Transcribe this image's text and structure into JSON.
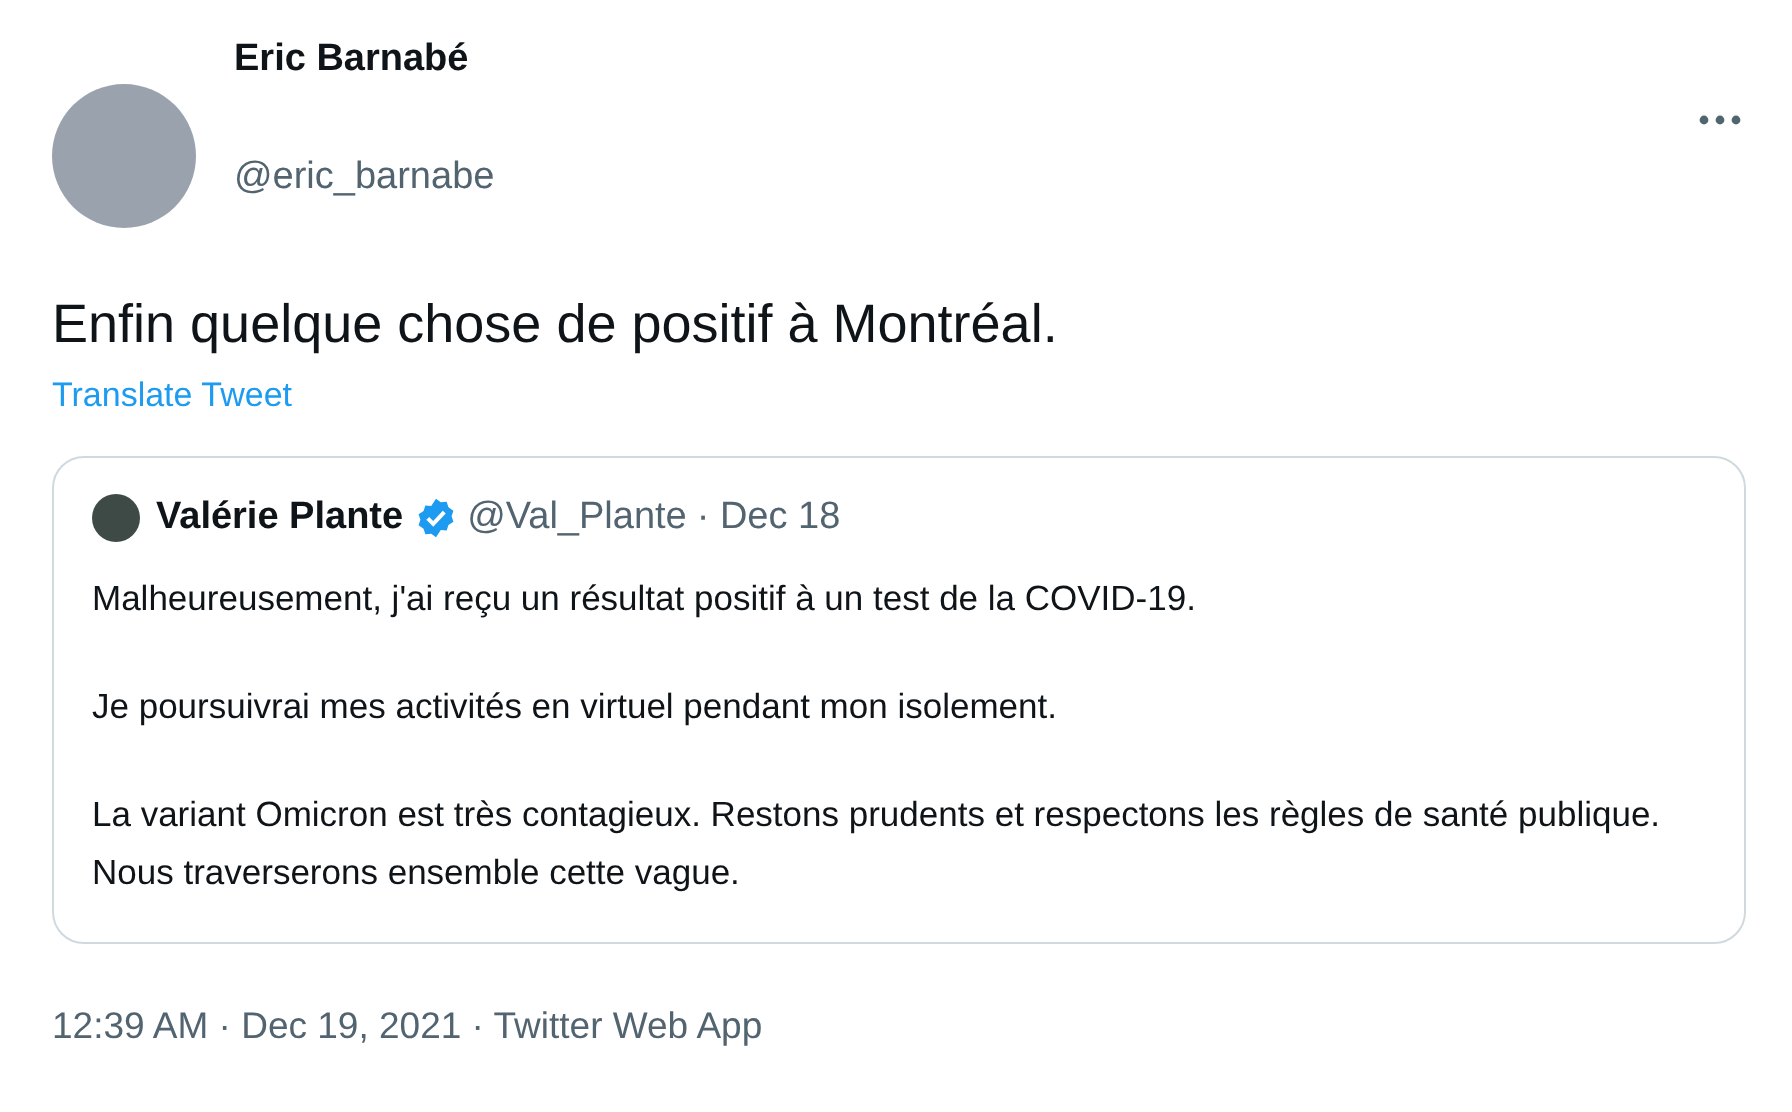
{
  "author": {
    "name": "Eric Barnabé",
    "handle": "@eric_barnabe"
  },
  "tweet_text": "Enfin quelque chose de positif à Montréal.",
  "translate_link": "Translate Tweet",
  "quoted_tweet": {
    "name": "Valérie Plante",
    "verified": true,
    "handle": "@Val_Plante",
    "date": "· Dec 18",
    "paragraphs": [
      "Malheureusement, j'ai reçu un résultat positif à un test de la COVID-19.",
      "Je poursuivrai mes activités en virtuel pendant mon isolement.",
      "La variant Omicron est très contagieux. Restons prudents et respectons les règles de santé publique. Nous traverserons ensemble cette vague."
    ]
  },
  "timestamp": "12:39 AM · Dec 19, 2021 · Twitter Web App"
}
